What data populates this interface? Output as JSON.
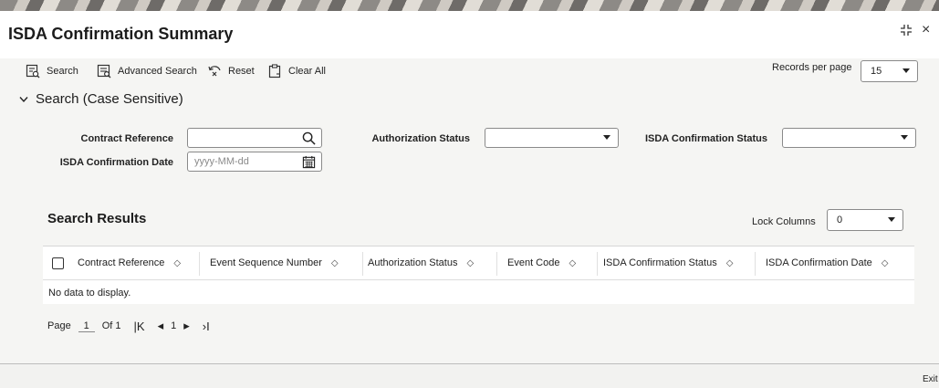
{
  "window": {
    "title": "ISDA Confirmation Summary",
    "expand_glyph": "⁚⁚",
    "close_glyph": "×"
  },
  "toolbar": {
    "search_label": "Search",
    "advanced_search_label": "Advanced Search",
    "reset_label": "Reset",
    "clear_all_label": "Clear All",
    "records_per_page_label": "Records per page",
    "records_per_page_value": "15"
  },
  "search_section": {
    "header": "Search (Case Sensitive)",
    "fields": {
      "contract_reference_label": "Contract Reference",
      "contract_reference_value": "",
      "authorization_status_label": "Authorization Status",
      "authorization_status_value": "",
      "isda_confirmation_status_label": "ISDA Confirmation Status",
      "isda_confirmation_status_value": "",
      "isda_confirmation_date_label": "ISDA Confirmation Date",
      "isda_confirmation_date_placeholder": "yyyy-MM-dd"
    }
  },
  "results": {
    "title": "Search Results",
    "lock_columns_label": "Lock Columns",
    "lock_columns_value": "0",
    "columns": [
      "Contract Reference",
      "Event Sequence Number",
      "Authorization Status",
      "Event Code",
      "ISDA Confirmation Status",
      "ISDA Confirmation Date"
    ],
    "empty_message": "No data to display."
  },
  "pagination": {
    "page_label": "Page",
    "current_page": "1",
    "of_label": "Of 1",
    "first_glyph": "K",
    "prev_glyph": "◂",
    "page_number": "1",
    "next_glyph": "▸",
    "last_glyph": "›I"
  },
  "footer": {
    "exit_label": "Exit"
  },
  "colors": {
    "accent_border": "#8a8a8a",
    "background": "#f5f5f3"
  }
}
